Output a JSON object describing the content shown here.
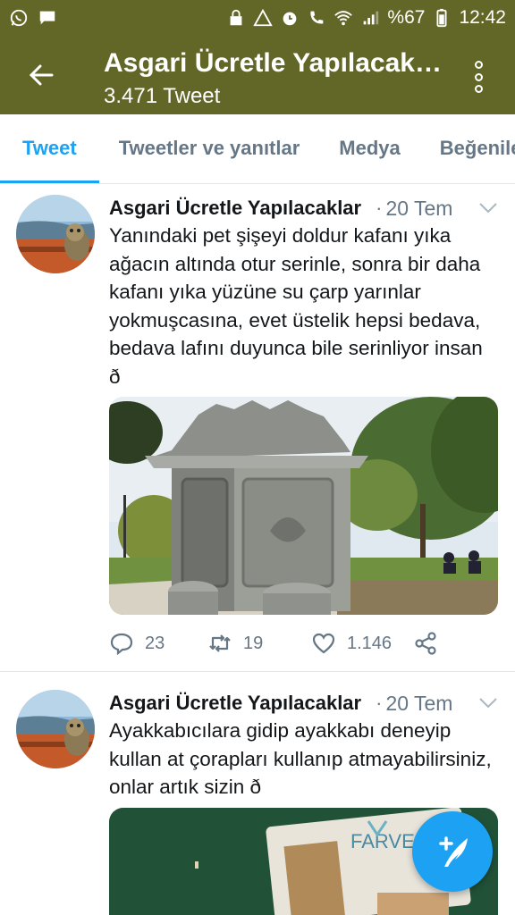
{
  "status_bar": {
    "battery_text": "%67",
    "time": "12:42"
  },
  "app_bar": {
    "title": "Asgari Ücretle Yapılacaklar",
    "subtitle": "3.471 Tweet"
  },
  "tabs": [
    {
      "label": "Tweet",
      "active": true
    },
    {
      "label": "Tweetler ve yanıtlar",
      "active": false
    },
    {
      "label": "Medya",
      "active": false
    },
    {
      "label": "Beğeniler",
      "active": false
    }
  ],
  "tweets": [
    {
      "author": "Asgari Ücretle Yapılacaklar",
      "separator": "·",
      "date": "20 Tem",
      "text": "Yanındaki pet şişeyi doldur kafanı yıka ağacın altında otur serinle, sonra bir daha kafanı yıka yüzüne su çarp yarınlar yokmuşcasına, evet üstelik hepsi bedava, bedava lafını duyunca bile serinliyor insan ð",
      "replies": "23",
      "retweets": "19",
      "likes": "1.146"
    },
    {
      "author": "Asgari Ücretle Yapılacaklar",
      "separator": "·",
      "date": "20 Tem",
      "text": "Ayakkabıcılara gidip ayakkabı deneyip kullan at çorapları kullanıp atmayabilirsiniz, onlar artık sizin ð",
      "media_label": "FARVE"
    }
  ],
  "colors": {
    "bar": "#626728",
    "accent": "#1da1f2",
    "muted": "#657786"
  },
  "icons": [
    "whatsapp-icon",
    "message-icon",
    "back-arrow-icon",
    "more-vert-icon",
    "chevron-down-icon",
    "reply-icon",
    "retweet-icon",
    "like-icon",
    "share-icon",
    "compose-icon"
  ]
}
